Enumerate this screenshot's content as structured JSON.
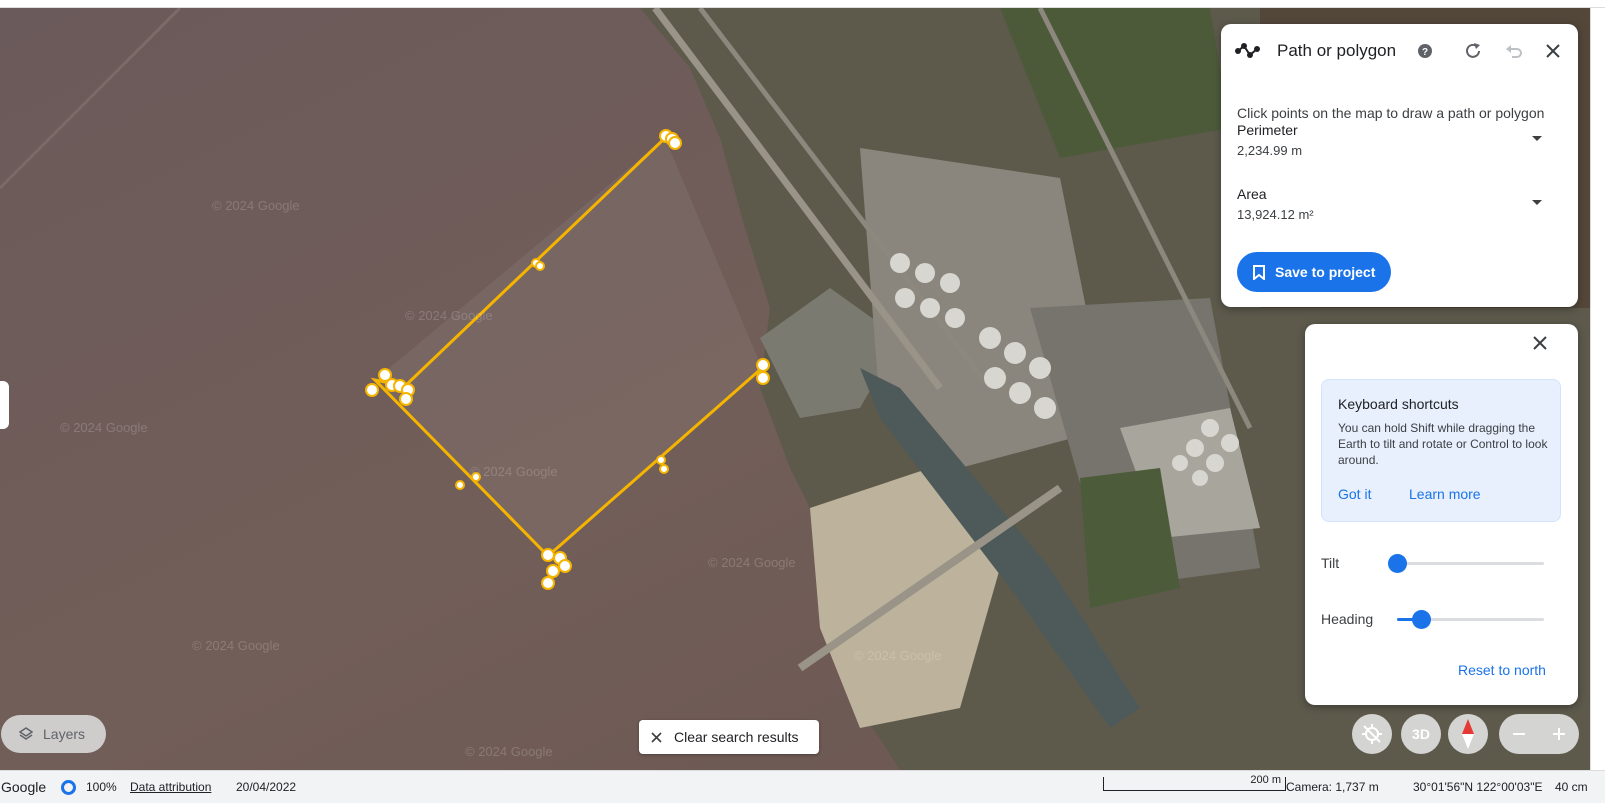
{
  "measure_panel": {
    "title": "Path or polygon",
    "description": "Click points on the map to draw a path or polygon",
    "perimeter_label": "Perimeter",
    "perimeter_value": "2,234.99 m",
    "area_label": "Area",
    "area_value": "13,924.12 m²",
    "save_label": "Save to project"
  },
  "nav_panel": {
    "shortcuts_title": "Keyboard shortcuts",
    "shortcuts_body": "You can hold Shift while dragging the Earth to tilt and rotate or Control to look around.",
    "got_it": "Got it",
    "learn_more": "Learn more",
    "tilt_label": "Tilt",
    "tilt_level": 0,
    "heading_label": "Heading",
    "heading_level": 0.16,
    "reset_label": "Reset to north"
  },
  "map": {
    "watermark": "© 2024 Google",
    "layers_label": "Layers",
    "clear_search_label": "Clear search results",
    "view_3d_label": "3D"
  },
  "status_bar": {
    "google": "Google",
    "load_percent": "100%",
    "attribution": "Data attribution",
    "imagery_date": "20/04/2022",
    "scale": "200 m",
    "camera": "Camera: 1,737 m",
    "coordinates": "30°01'56\"N 122°00'03\"E",
    "elevation": "40 cm"
  },
  "colors": {
    "accent": "#1a73e8",
    "polygon": "#f5b400",
    "water": "#6e5b58"
  }
}
